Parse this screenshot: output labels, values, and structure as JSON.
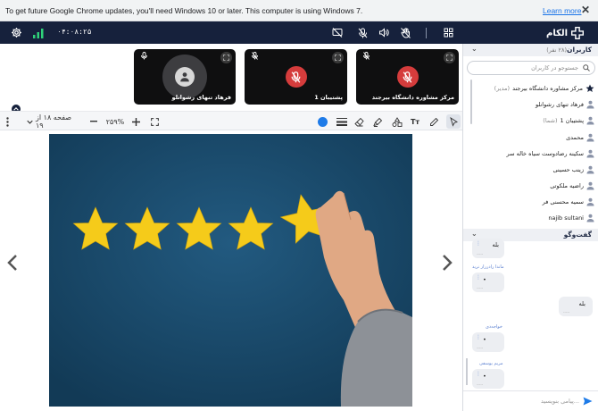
{
  "warning": {
    "message": "To get future Google Chrome updates, you'll need Windows 10 or later. This computer is using Windows 7.",
    "learn_more": "Learn more",
    "close": "✕"
  },
  "topbar": {
    "timer": "۰۴:۰۸:۲۵",
    "logo_text": "الکام",
    "icons": [
      "settings-icon",
      "signal-icon",
      "screen-share-off-icon",
      "mic-off-icon",
      "speaker-icon",
      "hand-raise-icon",
      "grid-layout-icon"
    ]
  },
  "tiles": [
    {
      "name": "فرهاد تنهای رشوانلو",
      "state": "avatar"
    },
    {
      "name": "پشتیبان 1",
      "state": "muted"
    },
    {
      "name": "مرکز مشاوره دانشگاه بیرجند",
      "state": "muted"
    }
  ],
  "toolbar": {
    "zoom": "۲۵۹%",
    "page": "صفحه ۱۸ از ۱۹",
    "text_tool": "Tт"
  },
  "users_panel": {
    "title": "کاربران",
    "count": "(۲۸ نفر)",
    "search_placeholder": "جستوجو در کاربران",
    "users": [
      {
        "name": "مرکز مشاوره دانشگاه بیرجند",
        "role": "(مدیر)"
      },
      {
        "name": "فرهاد تنهای رشوانلو",
        "role": ""
      },
      {
        "name": "پشتیبان 1",
        "role": "(شما)"
      },
      {
        "name": "محمدی",
        "role": ""
      },
      {
        "name": "سکینه رضادوست سیاه خاله سر",
        "role": ""
      },
      {
        "name": "زینب حسینی",
        "role": ""
      },
      {
        "name": "راضیه ملکوتی",
        "role": ""
      },
      {
        "name": "سمیه محسنی فر",
        "role": ""
      },
      {
        "name": "najib sultani",
        "role": ""
      }
    ]
  },
  "chat_panel": {
    "title": "گفت‌وگو",
    "messages": [
      {
        "sender": "",
        "text": "بله",
        "side": "left"
      },
      {
        "sender": "ماندا رادر‌رار نرید",
        "text": "•",
        "side": "left"
      },
      {
        "sender": "",
        "text": "بله",
        "side": "right"
      },
      {
        "sender": "خواجه‌دی",
        "text": "•",
        "side": "left"
      },
      {
        "sender": "مریم یوسفی",
        "text": "•",
        "side": "left"
      }
    ],
    "input_placeholder": "پیامی بنویسید..."
  },
  "colors": {
    "topbar": "#16213c",
    "accent": "#1e7be8",
    "mute": "#d53c3c",
    "star": "#f5cb1a",
    "slide_bg": "#174766"
  }
}
